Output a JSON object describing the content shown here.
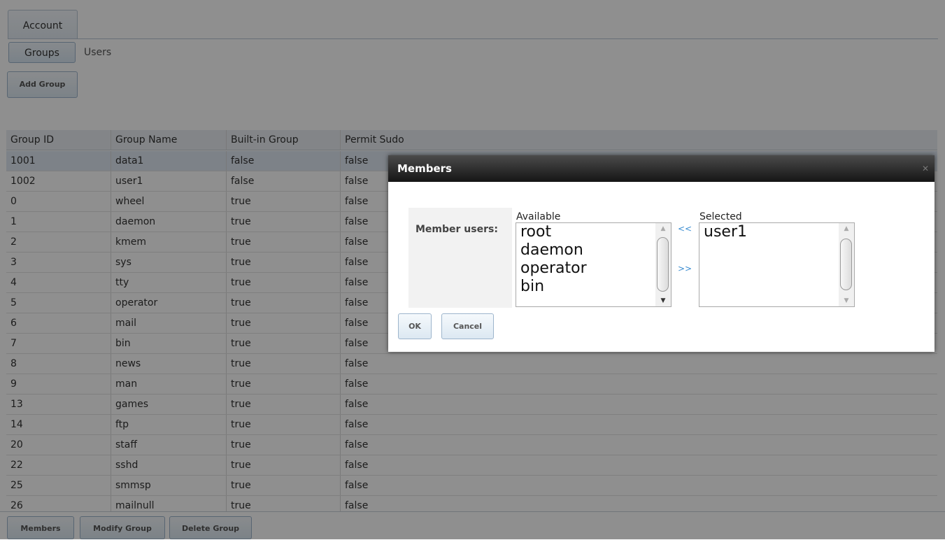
{
  "tabs": {
    "account": "Account"
  },
  "subtabs": {
    "groups": "Groups",
    "users": "Users"
  },
  "toolbar": {
    "add_group": "Add Group"
  },
  "grid": {
    "headers": [
      "Group ID",
      "Group Name",
      "Built-in Group",
      "Permit Sudo"
    ],
    "rows": [
      [
        "1001",
        "data1",
        "false",
        "false"
      ],
      [
        "1002",
        "user1",
        "false",
        "false"
      ],
      [
        "0",
        "wheel",
        "true",
        "false"
      ],
      [
        "1",
        "daemon",
        "true",
        "false"
      ],
      [
        "2",
        "kmem",
        "true",
        "false"
      ],
      [
        "3",
        "sys",
        "true",
        "false"
      ],
      [
        "4",
        "tty",
        "true",
        "false"
      ],
      [
        "5",
        "operator",
        "true",
        "false"
      ],
      [
        "6",
        "mail",
        "true",
        "false"
      ],
      [
        "7",
        "bin",
        "true",
        "false"
      ],
      [
        "8",
        "news",
        "true",
        "false"
      ],
      [
        "9",
        "man",
        "true",
        "false"
      ],
      [
        "13",
        "games",
        "true",
        "false"
      ],
      [
        "14",
        "ftp",
        "true",
        "false"
      ],
      [
        "20",
        "staff",
        "true",
        "false"
      ],
      [
        "22",
        "sshd",
        "true",
        "false"
      ],
      [
        "25",
        "smmsp",
        "true",
        "false"
      ],
      [
        "26",
        "mailnull",
        "true",
        "false"
      ]
    ]
  },
  "bottom": {
    "members": "Members",
    "modify_group": "Modify Group",
    "delete_group": "Delete Group"
  },
  "dialog": {
    "title": "Members",
    "member_users_label": "Member users:",
    "available_caption": "Available",
    "selected_caption": "Selected",
    "available": [
      "root",
      "daemon",
      "operator",
      "bin"
    ],
    "selected": [
      "user1"
    ],
    "move_left": "<<",
    "move_right": ">>",
    "ok": "OK",
    "cancel": "Cancel",
    "close_icon": "close-icon"
  }
}
